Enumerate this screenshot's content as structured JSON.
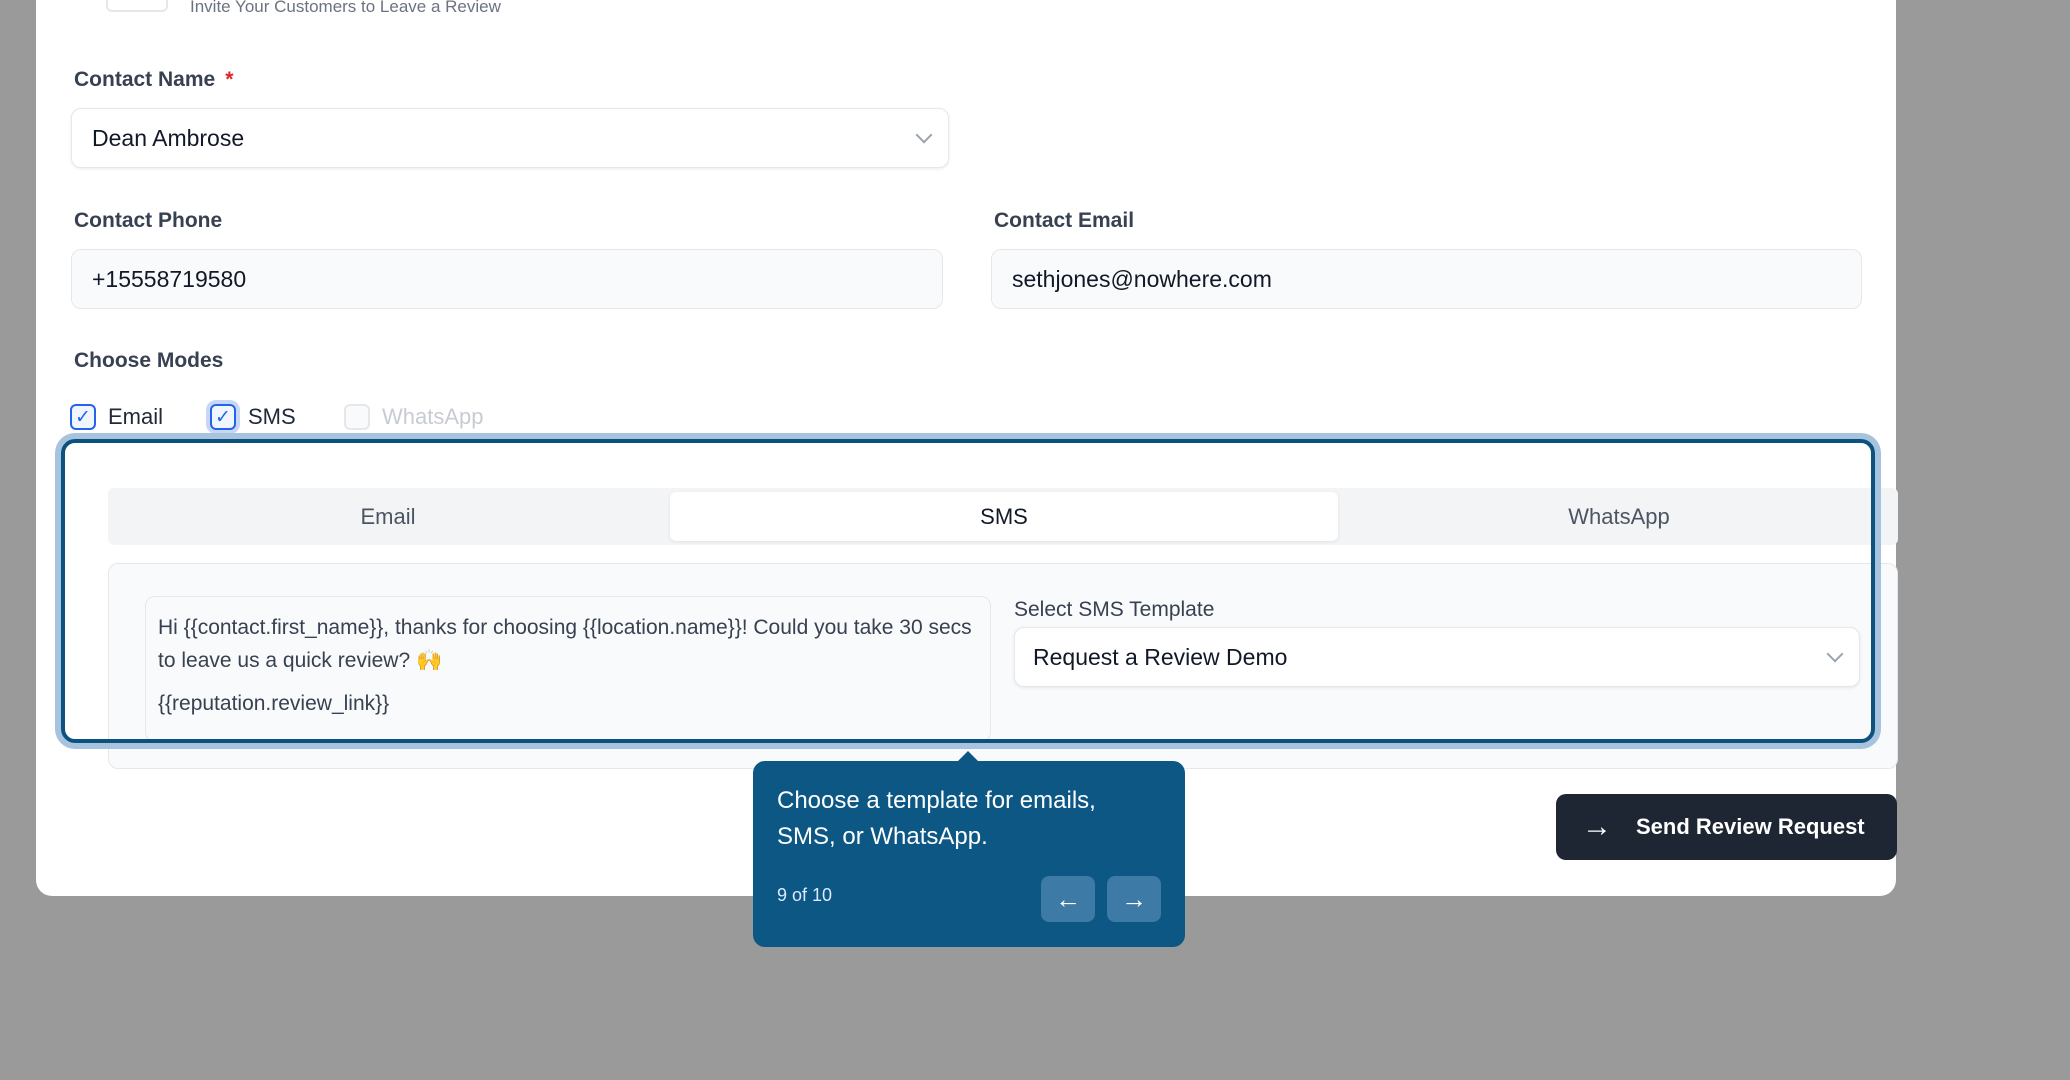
{
  "header": {
    "subtitle": "Invite Your Customers to Leave a Review"
  },
  "form": {
    "contact_name": {
      "label": "Contact Name",
      "required_mark": "*",
      "value": "Dean Ambrose"
    },
    "contact_phone": {
      "label": "Contact Phone",
      "value": "+15558719580"
    },
    "contact_email": {
      "label": "Contact Email",
      "value": "sethjones@nowhere.com"
    },
    "modes": {
      "label": "Choose Modes",
      "items": [
        {
          "label": "Email",
          "checked": true,
          "enabled": true
        },
        {
          "label": "SMS",
          "checked": true,
          "enabled": true
        },
        {
          "label": "WhatsApp",
          "checked": false,
          "enabled": false
        }
      ]
    }
  },
  "tabs": {
    "items": [
      "Email",
      "SMS",
      "WhatsApp"
    ],
    "active": "SMS"
  },
  "sms": {
    "message_line1": "Hi {{contact.first_name}}, thanks for choosing {{location.name}}! Could you take 30 secs to leave us a quick review? 🙌",
    "message_link": "{{reputation.review_link}}",
    "template_label": "Select SMS Template",
    "template_value": "Request a Review Demo"
  },
  "tour": {
    "text": "Choose a template for emails, SMS, or WhatsApp.",
    "step": "9 of 10",
    "prev_icon": "arrow-left-icon",
    "next_icon": "arrow-right-icon"
  },
  "actions": {
    "send_label": "Send Review Request"
  },
  "colors": {
    "tooltip_bg": "#0c5784",
    "highlight_border": "#0c527f",
    "send_button_bg": "#1e2533",
    "checkbox_accent": "#2563eb",
    "required": "#dc2626"
  }
}
